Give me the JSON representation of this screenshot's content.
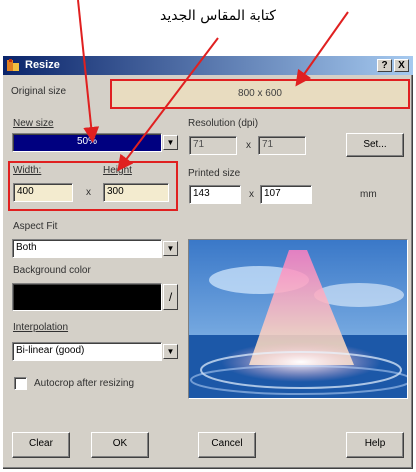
{
  "annotation": {
    "caption": "كتابة المقاس الجديد",
    "arrow_color": "#e02020"
  },
  "window": {
    "title": "Resize",
    "help_button": "?",
    "close_button": "X",
    "titlebar_color": "#0a246a"
  },
  "original_size": {
    "label": "Original size",
    "value": "800 x 600"
  },
  "new_size": {
    "label": "New size",
    "selected": "50%",
    "highlight_color": "#000080"
  },
  "width": {
    "label": "Width:",
    "value": "400"
  },
  "height": {
    "label": "Height",
    "value": "300"
  },
  "size_sep": "x",
  "resolution": {
    "label": "Resolution (dpi)",
    "x": "71",
    "y": "71",
    "sep": "x",
    "set_button": "Set..."
  },
  "printed_size": {
    "label": "Printed size",
    "w": "143",
    "h": "107",
    "sep": "x",
    "unit": "mm"
  },
  "aspect_fit": {
    "label": "Aspect Fit",
    "selected": "Both"
  },
  "background_color": {
    "label": "Background color",
    "swatch": "#000000"
  },
  "interpolation": {
    "label": "Interpolation",
    "selected": "Bi-linear (good)"
  },
  "autocrop": {
    "label": "Autocrop after resizing",
    "checked": false
  },
  "buttons": {
    "clear": "Clear",
    "ok": "OK",
    "cancel": "Cancel",
    "help": "Help"
  }
}
